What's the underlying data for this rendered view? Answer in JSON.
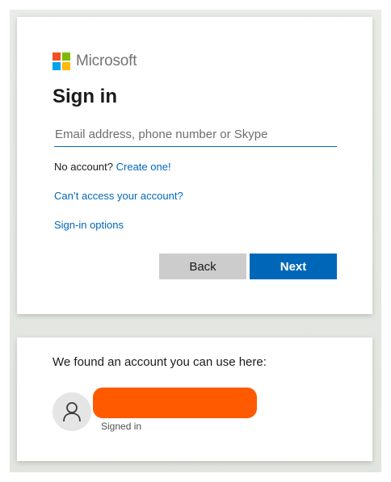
{
  "brand": {
    "name": "Microsoft",
    "logo_colors": [
      "#f25022",
      "#7fba00",
      "#00a4ef",
      "#ffb900"
    ]
  },
  "signin": {
    "title": "Sign in",
    "email_placeholder": "Email address, phone number or Skype",
    "email_value": "",
    "no_account_text": "No account?",
    "create_link": "Create one!",
    "cant_access_link": "Can’t access your account?",
    "signin_options_link": "Sign-in options",
    "back_label": "Back",
    "next_label": "Next"
  },
  "account_picker": {
    "heading": "We found an account you can use here:",
    "accounts": [
      {
        "name_redacted": true,
        "status": "Signed in",
        "avatar_icon": "person-icon"
      }
    ]
  },
  "colors": {
    "accent": "#0067b8",
    "redaction": "#ff5a00"
  }
}
